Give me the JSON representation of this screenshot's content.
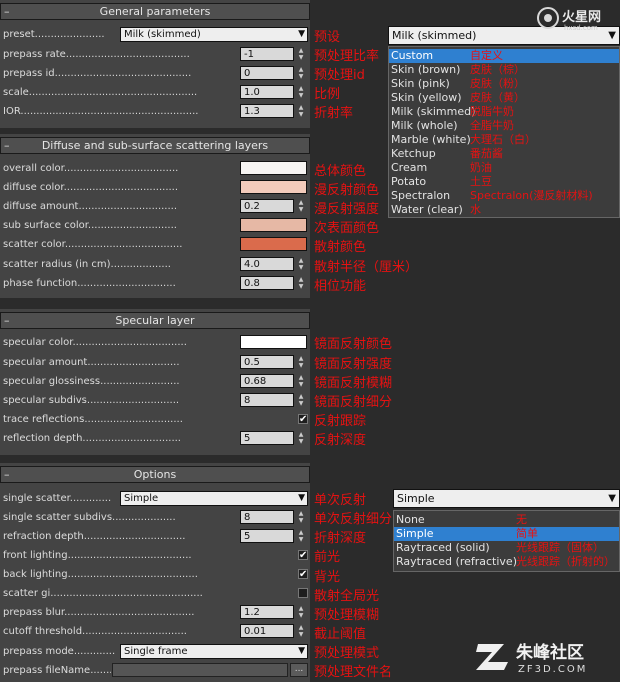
{
  "sections": {
    "general": "General parameters",
    "diffuse": "Diffuse and sub-surface scattering layers",
    "specular": "Specular layer",
    "options": "Options",
    "collapse_symbol": "–"
  },
  "general": {
    "preset_label": "preset......................",
    "preset_value": "Milk (skimmed)",
    "prepass_rate_label": "prepass rate.......................................",
    "prepass_rate_value": "-1",
    "prepass_id_label": "prepass id...........................................",
    "prepass_id_value": "0",
    "scale_label": "scale.....................................................",
    "scale_value": "1.0",
    "ior_label": "IOR........................................................",
    "ior_value": "1.3"
  },
  "diffuse": {
    "overall_color_label": "overall color....................................",
    "overall_color": "#f6f4f2",
    "diffuse_color_label": "diffuse color....................................",
    "diffuse_color": "#f3cbbb",
    "diffuse_amount_label": "diffuse amount...............................",
    "diffuse_amount_value": "0.2",
    "sub_surface_color_label": "sub surface color............................",
    "sub_surface_color": "#e6b8a5",
    "scatter_color_label": "scatter color.....................................",
    "scatter_color": "#da6b4c",
    "scatter_radius_label": "scatter radius (in cm)...................",
    "scatter_radius_value": "4.0",
    "phase_function_label": "phase function...............................",
    "phase_function_value": "0.8"
  },
  "specular": {
    "specular_color_label": "specular color....................................",
    "specular_color": "#ffffff",
    "specular_amount_label": "specular amount.............................",
    "specular_amount_value": "0.5",
    "specular_glossiness_label": "specular glossiness.........................",
    "specular_glossiness_value": "0.68",
    "specular_subdivs_label": "specular subdivs.............................",
    "specular_subdivs_value": "8",
    "trace_reflections_label": "trace reflections...............................",
    "trace_reflections_checked": "✔",
    "reflection_depth_label": "reflection depth...............................",
    "reflection_depth_value": "5"
  },
  "options": {
    "single_scatter_label": "single scatter.............",
    "single_scatter_value": "Simple",
    "single_scatter_subdivs_label": "single scatter subdivs....................",
    "single_scatter_subdivs_value": "8",
    "refraction_depth_label": "refraction depth................................",
    "refraction_depth_value": "5",
    "front_lighting_label": "front lighting.......................................",
    "front_lighting_checked": "✔",
    "back_lighting_label": "back lighting.........................................",
    "back_lighting_checked": "✔",
    "scatter_gi_label": "scatter gi................................................",
    "scatter_gi_checked": "",
    "prepass_blur_label": "prepass blur.........................................",
    "prepass_blur_value": "1.2",
    "cutoff_threshold_label": "cutoff threshold.................................",
    "cutoff_threshold_value": "0.01",
    "prepass_mode_label": "prepass mode.............",
    "prepass_mode_value": "Single frame",
    "prepass_filename_label": "prepass fileName..........",
    "browse_label": "..."
  },
  "annotations": {
    "preset": "预设",
    "prepass_rate": "预处理比率",
    "prepass_id": "预处理id",
    "scale": "比例",
    "ior": "折射率",
    "overall_color": "总体颜色",
    "diffuse_color": "漫反射颜色",
    "diffuse_amount": "漫反射强度",
    "sub_surface_color": "次表面颜色",
    "scatter_color": "散射颜色",
    "scatter_radius": "散射半径（厘米）",
    "phase_function": "相位功能",
    "specular_color": "镜面反射颜色",
    "specular_amount": "镜面反射强度",
    "specular_glossiness": "镜面反射模糊",
    "specular_subdivs": "镜面反射细分",
    "trace_reflections": "反射跟踪",
    "reflection_depth": "反射深度",
    "single_scatter": "单次反射",
    "single_scatter_subdivs": "单次反射细分",
    "refraction_depth": "折射深度",
    "front_lighting": "前光",
    "back_lighting": "背光",
    "scatter_gi": "散射全局光",
    "prepass_blur": "预处理模糊",
    "cutoff_threshold": "截止阈值",
    "prepass_mode": "预处理模式",
    "prepass_filename": "预处理文件名"
  },
  "preset_dropdown": {
    "selected": "Milk (skimmed)",
    "items": [
      {
        "label": "Custom",
        "note": "自定义"
      },
      {
        "label": "Skin (brown)",
        "note": "皮肤（棕）"
      },
      {
        "label": "Skin (pink)",
        "note": "皮肤（粉）"
      },
      {
        "label": "Skin (yellow)",
        "note": "皮肤（黄）"
      },
      {
        "label": "Milk (skimmed)",
        "note": "脱脂牛奶"
      },
      {
        "label": "Milk (whole)",
        "note": "全脂牛奶"
      },
      {
        "label": "Marble (white)",
        "note": "大理石（白）"
      },
      {
        "label": "Ketchup",
        "note": "番茄酱"
      },
      {
        "label": "Cream",
        "note": "奶油"
      },
      {
        "label": "Potato",
        "note": "土豆"
      },
      {
        "label": "Spectralon",
        "note": "Spectralon(漫反射材料)"
      },
      {
        "label": "Water (clear)",
        "note": "水"
      }
    ]
  },
  "scatter_dropdown": {
    "selected": "Simple",
    "items": [
      {
        "label": "None",
        "note": "无"
      },
      {
        "label": "Simple",
        "note": "简单"
      },
      {
        "label": "Raytraced (solid)",
        "note": "光线跟踪（固体）"
      },
      {
        "label": "Raytraced (refractive)",
        "note": "光线跟踪（折射的）"
      }
    ]
  },
  "watermarks": {
    "top_logo": "火星网 hxsd.com",
    "bottom_logo": "朱峰社区 ZF3D.COM"
  },
  "colors": {
    "annotation": "#e51212",
    "selection": "#2f80d0",
    "panel_bg": "#444444"
  }
}
